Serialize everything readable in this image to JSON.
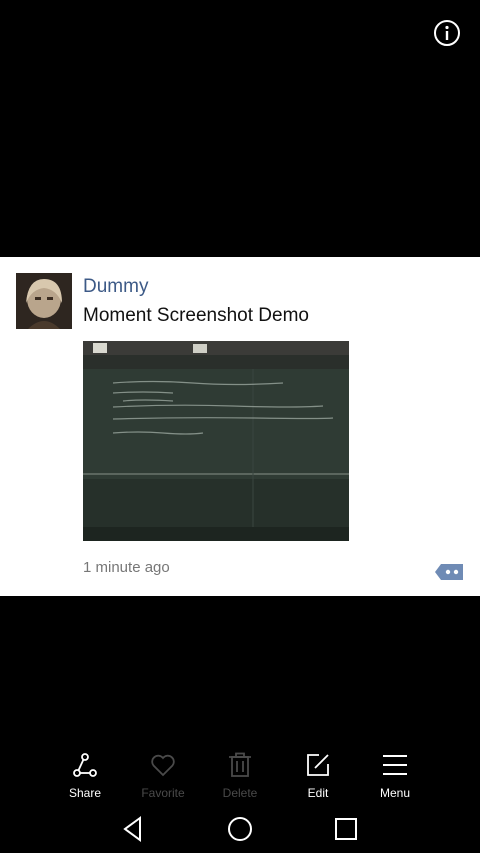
{
  "info": {
    "label": "i"
  },
  "post": {
    "user_name": "Dummy",
    "text": "Moment Screenshot Demo",
    "time_ago": "1 minute ago",
    "photo_desc": "blackboard photo"
  },
  "toolbar": {
    "share": "Share",
    "favorite": "Favorite",
    "delete": "Delete",
    "edit": "Edit",
    "menu": "Menu"
  },
  "colors": {
    "background": "#000000",
    "card": "#ffffff",
    "user_name": "#3d5a87",
    "comment_icon": "#6f8bb5",
    "enabled": "#ffffff",
    "disabled": "#4a4a4a"
  },
  "icons": [
    "info-icon",
    "comment-icon",
    "share-icon",
    "heart-icon",
    "trash-icon",
    "edit-icon",
    "menu-icon",
    "back-icon",
    "home-icon",
    "recents-icon"
  ]
}
